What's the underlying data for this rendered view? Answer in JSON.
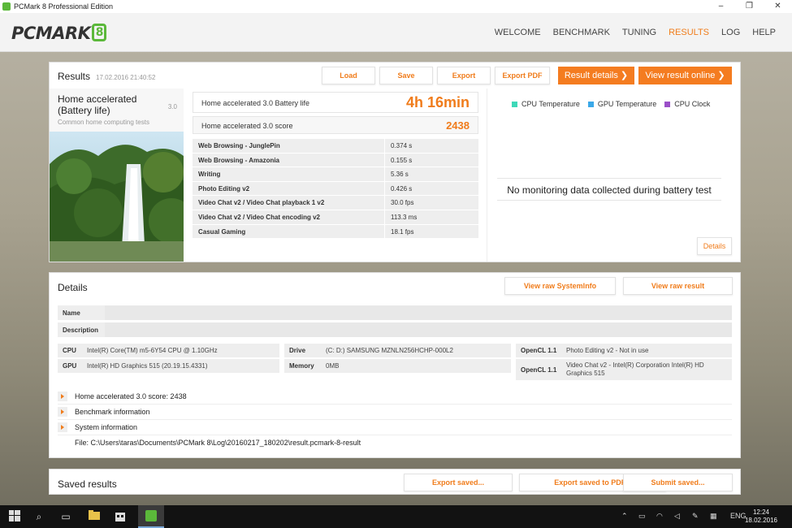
{
  "window": {
    "title": "PCMark 8 Professional Edition",
    "minimize": "–",
    "maximize": "❐",
    "close": "✕"
  },
  "logo": {
    "text": "PCMARK",
    "number": "8"
  },
  "nav": [
    "WELCOME",
    "BENCHMARK",
    "TUNING",
    "RESULTS",
    "LOG",
    "HELP"
  ],
  "nav_active": "RESULTS",
  "results": {
    "title": "Results",
    "timestamp": "17.02.2016 21:40:52",
    "buttons": {
      "load": "Load",
      "save": "Save",
      "export": "Export",
      "export_pdf": "Export PDF",
      "result_details": "Result details ❯",
      "view_online": "View result online ❯"
    },
    "benchmark_name": "Home accelerated (Battery life)",
    "benchmark_version": "3.0",
    "benchmark_subtitle": "Common home computing tests",
    "battery_label": "Home accelerated 3.0 Battery life",
    "battery_value": "4h 16min",
    "score_label": "Home accelerated 3.0 score",
    "score_value": "2438",
    "subtests": [
      {
        "name": "Web Browsing - JunglePin",
        "value": "0.374 s"
      },
      {
        "name": "Web Browsing - Amazonia",
        "value": "0.155 s"
      },
      {
        "name": "Writing",
        "value": "5.36 s"
      },
      {
        "name": "Photo Editing v2",
        "value": "0.426 s"
      },
      {
        "name": "Video Chat v2 / Video Chat playback 1 v2",
        "value": "30.0 fps"
      },
      {
        "name": "Video Chat v2 / Video Chat encoding v2",
        "value": "113.3 ms"
      },
      {
        "name": "Casual Gaming",
        "value": "18.1 fps"
      }
    ],
    "legend": [
      {
        "label": "CPU Temperature",
        "color": "#3ed8b8"
      },
      {
        "label": "GPU Temperature",
        "color": "#3aa8e8"
      },
      {
        "label": "CPU Clock",
        "color": "#9b4fc8"
      }
    ],
    "no_data": "No monitoring data collected during battery test",
    "details_button": "Details"
  },
  "details": {
    "title": "Details",
    "view_sysinfo": "View raw SystemInfo",
    "view_raw": "View raw result",
    "name_label": "Name",
    "name_value": "",
    "description_label": "Description",
    "description_value": "",
    "cpu_label": "CPU",
    "cpu_value": "Intel(R) Core(TM) m5-6Y54 CPU @ 1.10GHz",
    "gpu_label": "GPU",
    "gpu_value": "Intel(R) HD Graphics 515 (20.19.15.4331)",
    "drive_label": "Drive",
    "drive_value": "(C: D:) SAMSUNG MZNLN256HCHP-000L2",
    "memory_label": "Memory",
    "memory_value": "0MB",
    "opencl1_label": "OpenCL 1.1",
    "opencl1_value": "Photo Editing v2 - Not in use",
    "opencl2_label": "OpenCL 1.1",
    "opencl2_value": "Video Chat v2 - Intel(R) Corporation Intel(R) HD Graphics 515",
    "expanders": [
      "Home accelerated 3.0 score: 2438",
      "Benchmark information",
      "System information"
    ],
    "file": "File: C:\\Users\\taras\\Documents\\PCMark 8\\Log\\20160217_180202\\result.pcmark-8-result"
  },
  "saved": {
    "title": "Saved results",
    "export_saved": "Export saved...",
    "export_pdf": "Export saved to PDF...",
    "submit": "Submit saved..."
  },
  "taskbar": {
    "lang": "ENG",
    "time": "12:24",
    "date": "18.02.2016"
  }
}
